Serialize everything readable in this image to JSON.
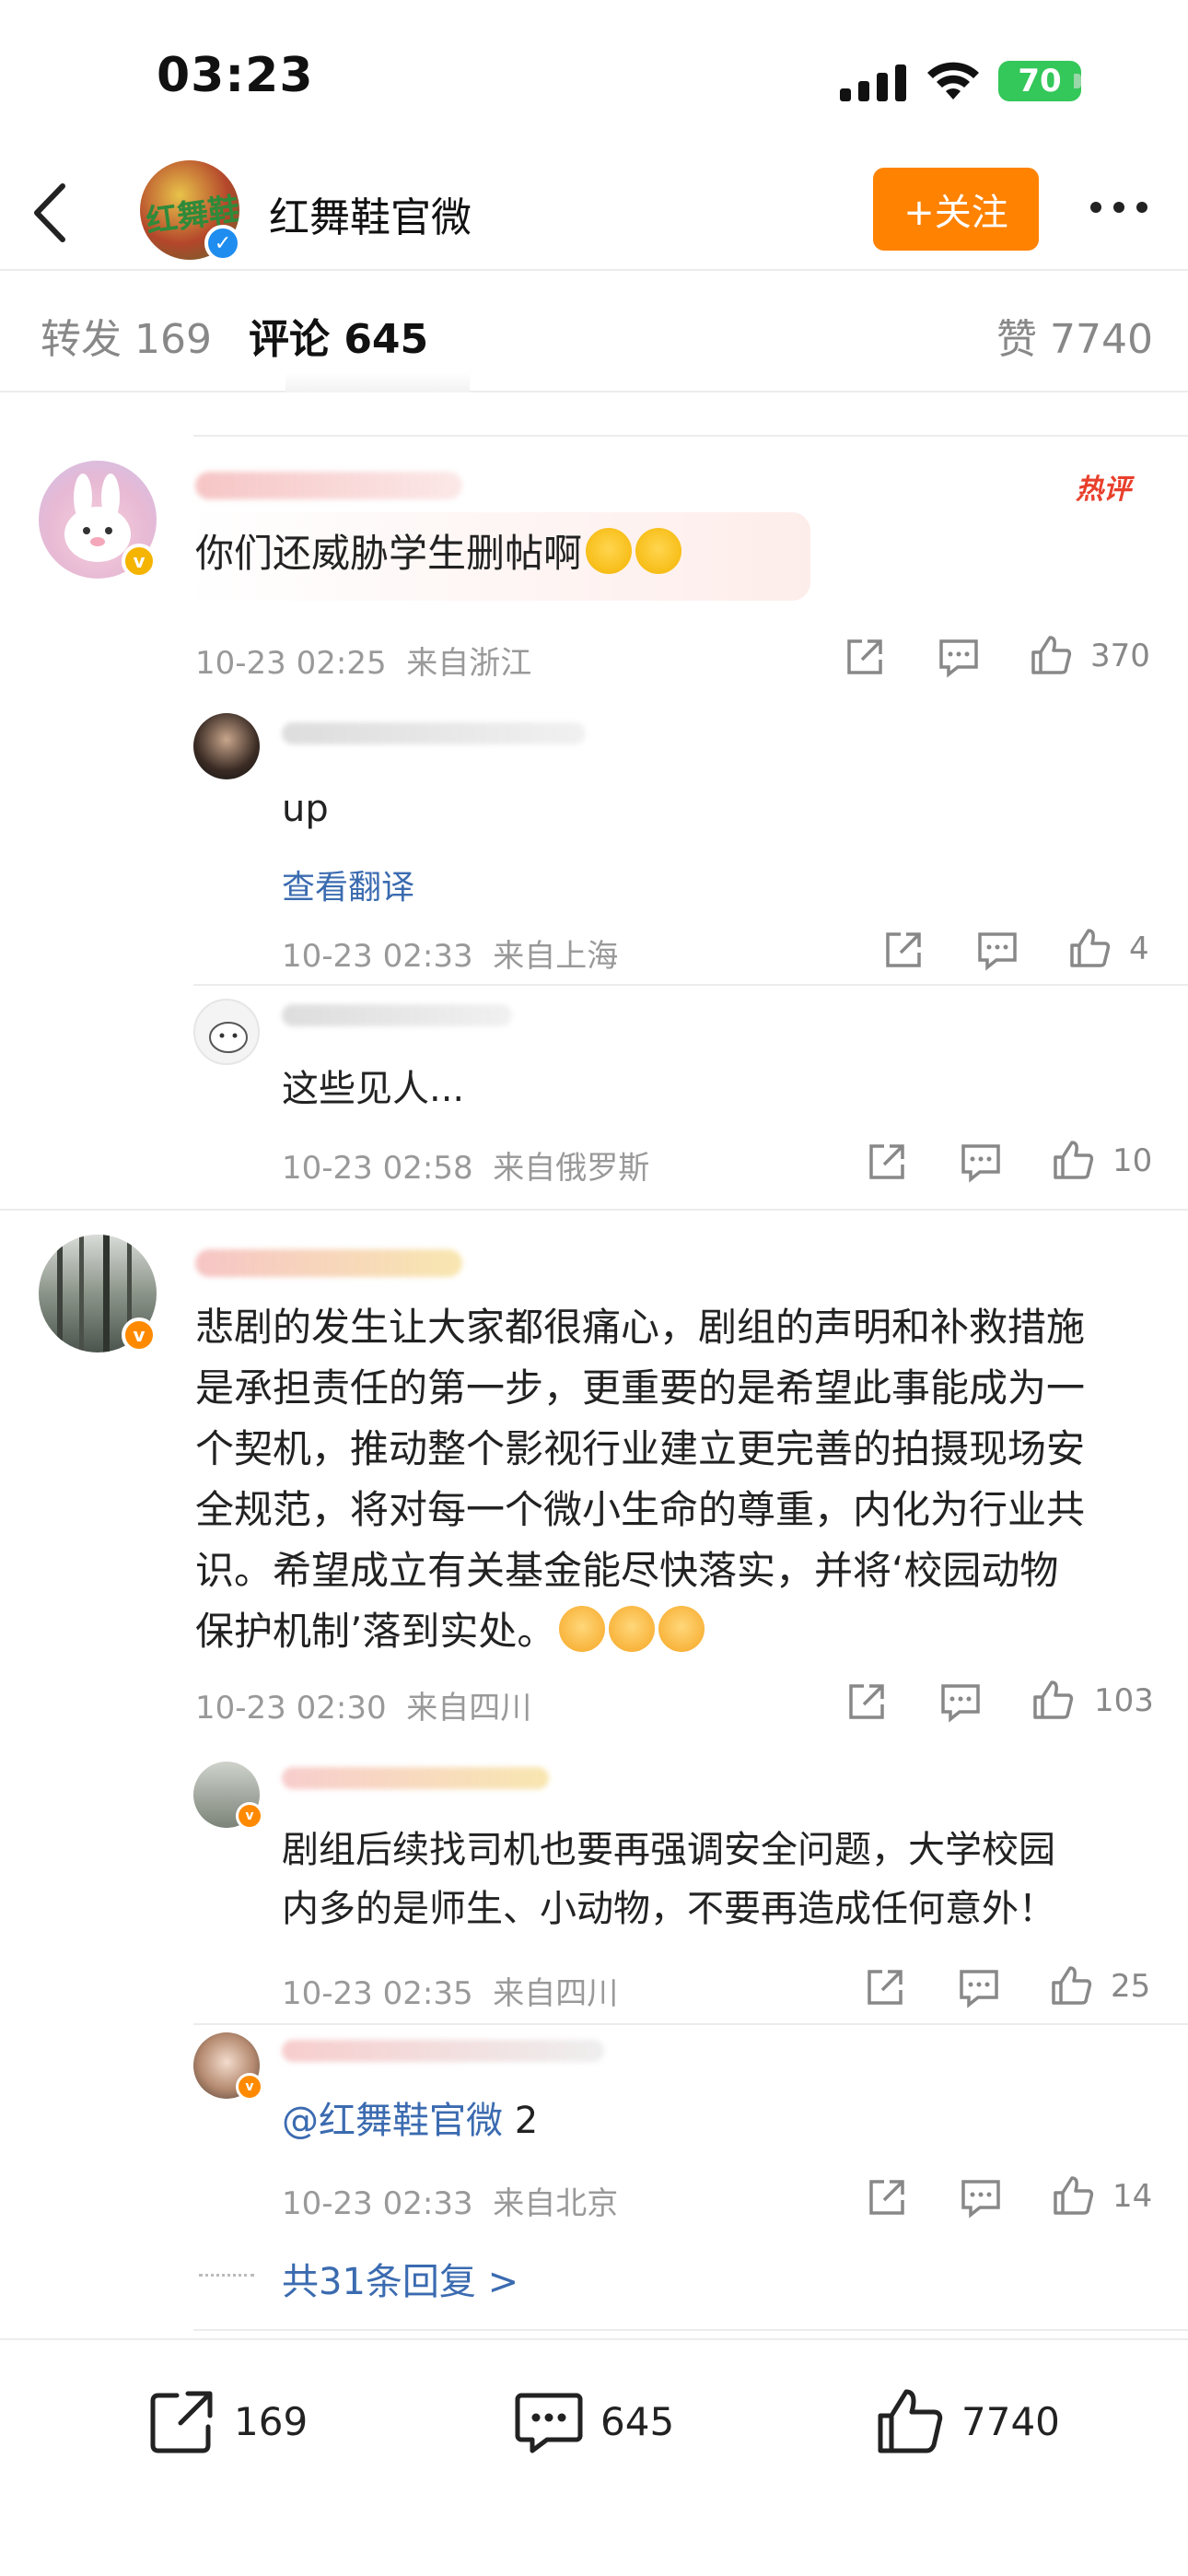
{
  "status_bar": {
    "time": "03:23",
    "battery": "70"
  },
  "header": {
    "title": "红舞鞋官微",
    "follow_label": "+关注",
    "avatar_logo": "红舞鞋"
  },
  "tabs": [
    {
      "label": "转发 169"
    },
    {
      "label": "评论 645"
    },
    {
      "label": "赞 7740"
    }
  ],
  "comments": [
    {
      "text": "你们还威胁学生删帖啊",
      "hot_label": "热评",
      "time": "10-23 02:25",
      "location": "来自浙江",
      "likes": "370",
      "replies": [
        {
          "text": "up",
          "translate": "查看翻译",
          "time": "10-23 02:33",
          "location": "来自上海",
          "likes": "4"
        },
        {
          "text": "这些见人...",
          "time": "10-23 02:58",
          "location": "来自俄罗斯",
          "likes": "10"
        }
      ]
    },
    {
      "text_lines": [
        "悲剧的发生让大家都很痛心，剧组的声明和补救措施",
        "是承担责任的第一步，更重要的是希望此事能成为一",
        "个契机，推动整个影视行业建立更完善的拍摄现场安",
        "全规范，将对每一个微小生命的尊重，内化为行业共",
        "识。希望成立有关基金能尽快落实，并将‘校园动物",
        "保护机制’落到实处。"
      ],
      "time": "10-23 02:30",
      "location": "来自四川",
      "likes": "103",
      "replies": [
        {
          "text_lines": [
            "剧组后续找司机也要再强调安全问题，大学校园",
            "内多的是师生、小动物，不要再造成任何意外！"
          ],
          "time": "10-23 02:35",
          "location": "来自四川",
          "likes": "25"
        },
        {
          "mention": "@红舞鞋官微",
          "text": " 2",
          "time": "10-23 02:33",
          "location": "来自北京",
          "likes": "14"
        }
      ],
      "more_replies": "共31条回复 >"
    }
  ],
  "bottom_bar": {
    "reposts": "169",
    "comments": "645",
    "likes": "7740"
  },
  "colors": {
    "accent": "#ff8200",
    "link": "#3b6bb0",
    "hot": "#e8402c"
  }
}
